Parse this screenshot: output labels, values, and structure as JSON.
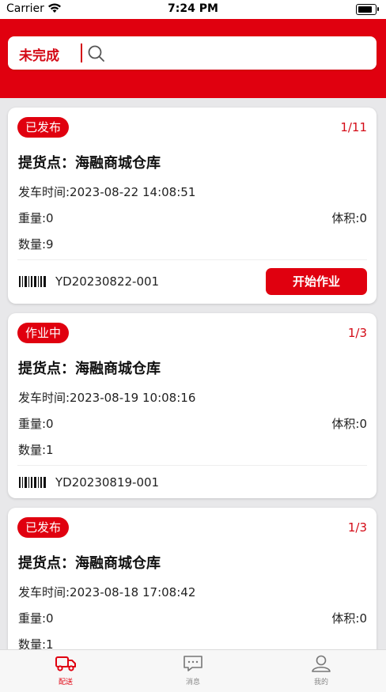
{
  "status_bar": {
    "carrier": "Carrier",
    "time": "7:24 PM"
  },
  "search": {
    "filter_label": "未完成",
    "placeholder": ""
  },
  "orders": [
    {
      "status": "已发布",
      "page": "1/11",
      "pickup": "提货点：海融商城仓库",
      "depart_time": "发车时间:2023-08-22 14:08:51",
      "weight": "重量:0",
      "volume": "体积:0",
      "quantity": "数量:9",
      "code": "YD20230822-001",
      "action": "开始作业"
    },
    {
      "status": "作业中",
      "page": "1/3",
      "pickup": "提货点：海融商城仓库",
      "depart_time": "发车时间:2023-08-19 10:08:16",
      "weight": "重量:0",
      "volume": "体积:0",
      "quantity": "数量:1",
      "code": "YD20230819-001"
    },
    {
      "status": "已发布",
      "page": "1/3",
      "pickup": "提货点：海融商城仓库",
      "depart_time": "发车时间:2023-08-18 17:08:42",
      "weight": "重量:0",
      "volume": "体积:0",
      "quantity": "数量:1"
    }
  ],
  "tabbar": {
    "delivery": "配送",
    "messages": "消息",
    "mine": "我的"
  },
  "colors": {
    "brand_red": "#e0000f"
  }
}
